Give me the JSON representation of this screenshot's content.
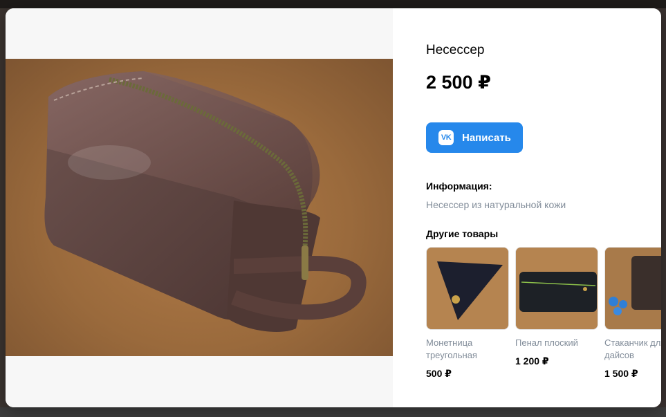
{
  "product": {
    "title": "Несессер",
    "price": "2 500 ₽",
    "write_button": "Написать",
    "write_icon": "vk-logo-icon",
    "info_heading": "Информация:",
    "info_text": "Несессер из натуральной кожи",
    "others_heading": "Другие товары"
  },
  "other_products": [
    {
      "name": "Монетница\nтреугольная",
      "price": "500 ₽"
    },
    {
      "name": "Пенал плоский",
      "price": "1 200 ₽"
    },
    {
      "name": "Стаканчик для\nдайсов",
      "price": "1 500 ₽"
    }
  ],
  "colors": {
    "accent": "#2688eb",
    "muted_text": "#818c99"
  }
}
